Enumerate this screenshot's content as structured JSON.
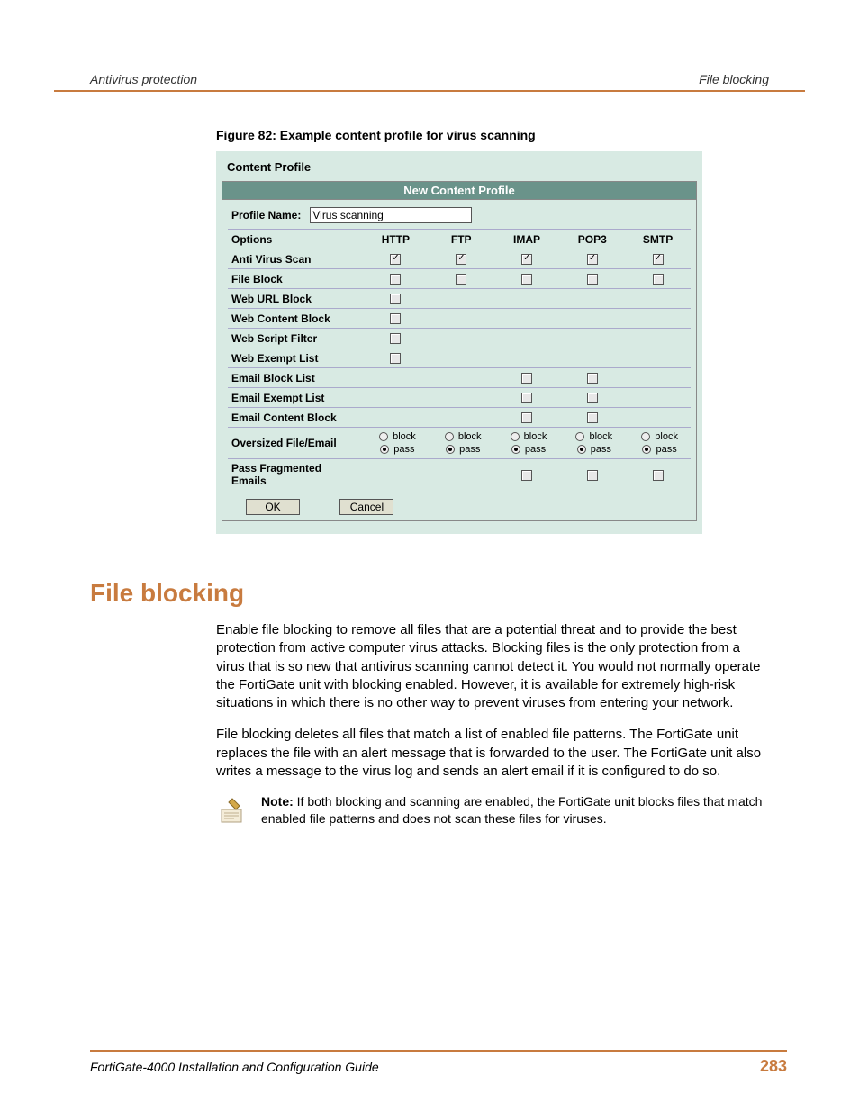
{
  "header": {
    "left": "Antivirus protection",
    "right": "File blocking"
  },
  "figure_caption": "Figure 82: Example content profile for virus scanning",
  "profile": {
    "tab_label": "Content Profile",
    "panel_title": "New Content Profile",
    "name_label": "Profile Name:",
    "name_value": "Virus scanning",
    "columns": [
      "Options",
      "HTTP",
      "FTP",
      "IMAP",
      "POP3",
      "SMTP"
    ],
    "rows": [
      {
        "label": "Anti Virus Scan",
        "cells": [
          "checked",
          "checked",
          "checked",
          "checked",
          "checked"
        ]
      },
      {
        "label": "File Block",
        "cells": [
          "unchecked",
          "unchecked",
          "unchecked",
          "unchecked",
          "unchecked"
        ]
      },
      {
        "label": "Web URL Block",
        "cells": [
          "unchecked",
          "",
          "",
          "",
          ""
        ]
      },
      {
        "label": "Web Content Block",
        "cells": [
          "unchecked",
          "",
          "",
          "",
          ""
        ]
      },
      {
        "label": "Web Script Filter",
        "cells": [
          "unchecked",
          "",
          "",
          "",
          ""
        ]
      },
      {
        "label": "Web Exempt List",
        "cells": [
          "unchecked",
          "",
          "",
          "",
          ""
        ]
      },
      {
        "label": "Email Block List",
        "cells": [
          "",
          "",
          "unchecked",
          "unchecked",
          ""
        ]
      },
      {
        "label": "Email Exempt List",
        "cells": [
          "",
          "",
          "unchecked",
          "unchecked",
          ""
        ]
      },
      {
        "label": "Email Content Block",
        "cells": [
          "",
          "",
          "unchecked",
          "unchecked",
          ""
        ]
      },
      {
        "label": "Oversized File/Email",
        "type": "radio",
        "cells": [
          "pass",
          "pass",
          "pass",
          "pass",
          "pass"
        ]
      },
      {
        "label": "Pass Fragmented Emails",
        "cells": [
          "",
          "",
          "unchecked",
          "unchecked",
          "unchecked"
        ]
      }
    ],
    "radio_block": "block",
    "radio_pass": "pass",
    "ok_label": "OK",
    "cancel_label": "Cancel"
  },
  "section_heading": "File blocking",
  "para1": "Enable file blocking to remove all files that are a potential threat and to provide the best protection from active computer virus attacks. Blocking files is the only protection from a virus that is so new that antivirus scanning cannot detect it. You would not normally operate the FortiGate unit with blocking enabled. However, it is available for extremely high-risk situations in which there is no other way to prevent viruses from entering your network.",
  "para2": "File blocking deletes all files that match a list of enabled file patterns. The FortiGate unit replaces the file with an alert message that is forwarded to the user. The FortiGate unit also writes a message to the virus log and sends an alert email if it is configured to do so.",
  "note_label": "Note:",
  "note_text": " If both blocking and scanning are enabled, the FortiGate unit blocks files that match enabled file patterns and does not scan these files for viruses.",
  "footer": {
    "title": "FortiGate-4000 Installation and Configuration Guide",
    "page": "283"
  }
}
